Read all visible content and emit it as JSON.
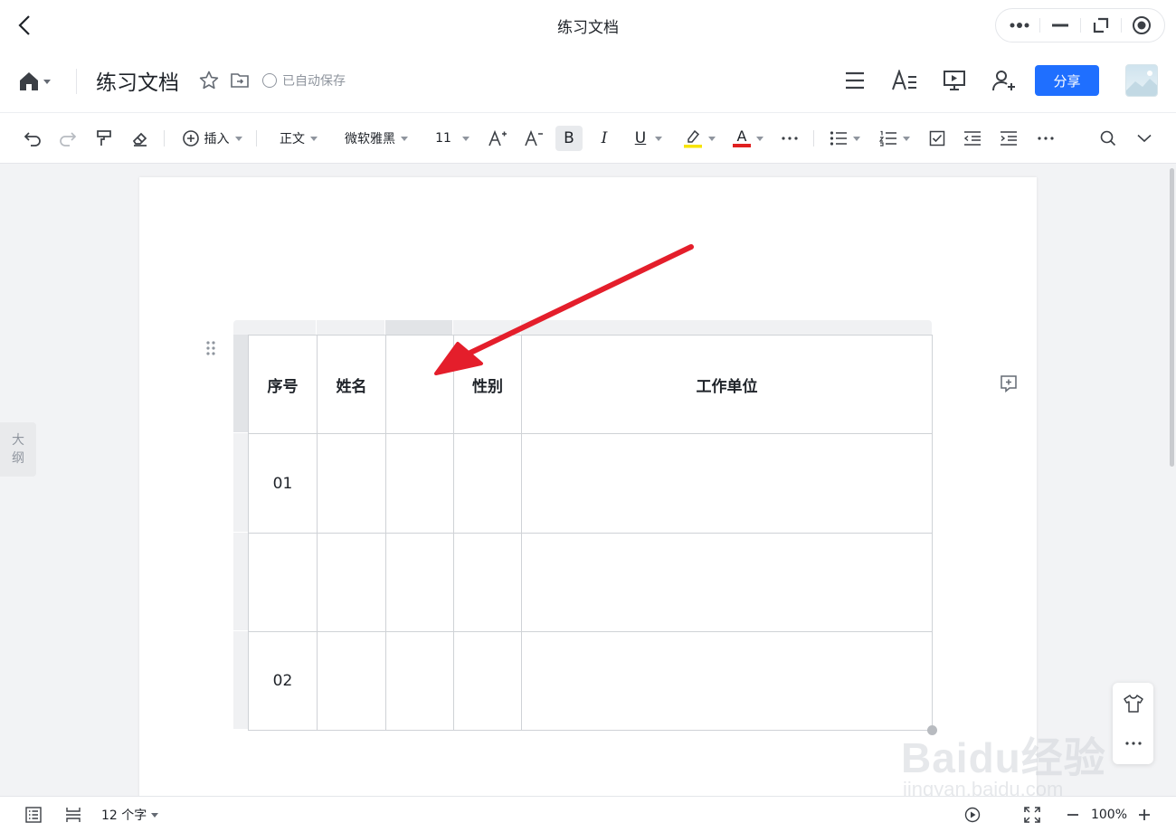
{
  "window": {
    "title": "练习文档",
    "back_icon": "chevron-left-icon",
    "controls": [
      "more-dots-icon",
      "minimize-icon",
      "restore-icon",
      "record-icon"
    ]
  },
  "header": {
    "doc_title": "练习文档",
    "autosave": "已自动保存",
    "share_label": "分享"
  },
  "toolbar": {
    "insert": "插入",
    "paragraph_style": "正文",
    "font": "微软雅黑",
    "font_size": "11",
    "bold": "B",
    "italic": "I",
    "underline": "U",
    "font_color": "A",
    "highlight_color": "#f7e400",
    "text_color": "#e02020"
  },
  "outline": {
    "label_1": "大",
    "label_2": "纲"
  },
  "table": {
    "headers": [
      "序号",
      "姓名",
      "",
      "性别",
      "工作单位"
    ],
    "rows": [
      [
        "01",
        "",
        "",
        "",
        ""
      ],
      [
        "",
        "",
        "",
        "",
        ""
      ],
      [
        "02",
        "",
        "",
        "",
        ""
      ]
    ]
  },
  "status": {
    "word_count": "12 个字",
    "zoom": "100%"
  },
  "watermark": {
    "brand": "Baidu经验",
    "url": "jingyan.baidu.com"
  },
  "colors": {
    "accent": "#1f6fff",
    "annotation_arrow": "#e41e2b"
  }
}
